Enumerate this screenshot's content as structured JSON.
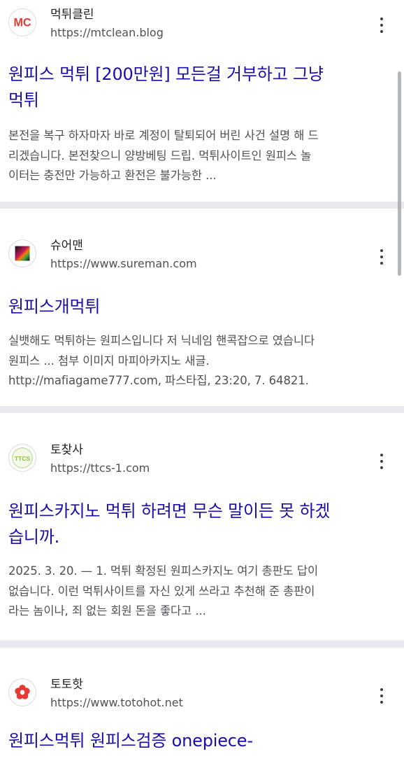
{
  "results": [
    {
      "site_name": "먹튀클린",
      "url": "https://mtclean.blog",
      "favicon": "mc-logo-icon",
      "favicon_text": "MC",
      "title_line1": "원피스 먹튀 [200만원] 모든걸 거부하고 그냥",
      "title_line2": "먹튀",
      "snippet_line1": "본전을 복구 하자마자 바로 계정이 탈퇴되어 버린 사건 설명 해 드",
      "snippet_line2": "리겠습니다. 본전찾으니 양방베팅 드립. 먹튀사이트인 원피스 놀",
      "snippet_line3": "이터는 충전만 가능하고 환전은 불가능한 ..."
    },
    {
      "site_name": "슈어맨",
      "url": "https://www.sureman.com",
      "favicon": "sureman-logo-icon",
      "title_line1": "원피스개먹튀",
      "snippet_line1": "실뱃해도 먹튀하는 원피스입니다 저 닉네임 핸콕잡으로 였습니다",
      "snippet_line2": "원피스 ... 첨부 이미지 마피아카지노 새글.",
      "snippet_line3": "http://mafiagame777.com, 파스타집, 23:20, 7. 64821."
    },
    {
      "site_name": "토찾사",
      "url": "https://ttcs-1.com",
      "favicon": "ttcs-logo-icon",
      "favicon_text": "TTCS",
      "title_line1": "원피스카지노 먹튀 하려면 무슨 말이든 못 하겠",
      "title_line2": "습니까.",
      "snippet_line1": "2025. 3. 20. — 1. 먹튀 확정된 원피스카지노 여기 총판도 답이",
      "snippet_line2": "없습니다. 이런 먹튀사이트를 자신 있게 쓰라고 추천해 준 총판이",
      "snippet_line3": "라는 놈이나, 죄 없는 회원 돈을 좋다고 ..."
    },
    {
      "site_name": "토토핫",
      "url": "https://www.totohot.net",
      "favicon": "totohot-flower-icon",
      "title_line1": "원피스먹튀 원피스검증 onepiece-"
    }
  ],
  "colors": {
    "title_link": "#1a0dab",
    "snippet_text": "#4d5156",
    "separator": "#e8eaed",
    "mc_red": "#e53935",
    "ttcs_green": "#8bc34a",
    "totohot_red": "#e53935"
  }
}
